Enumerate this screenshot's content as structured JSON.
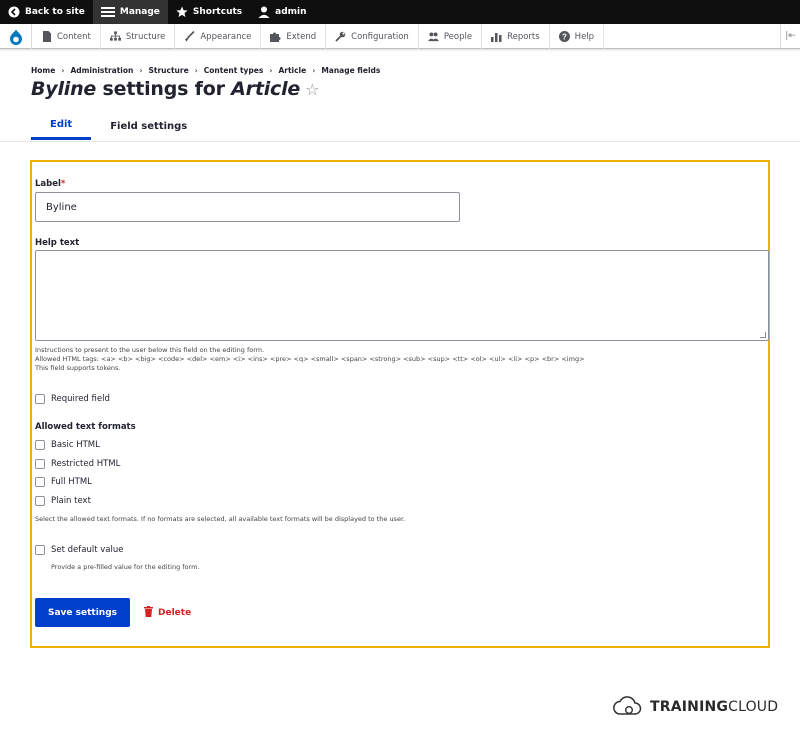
{
  "toolbar": {
    "back_to_site": "Back to site",
    "manage": "Manage",
    "shortcuts": "Shortcuts",
    "user": "admin"
  },
  "tray": {
    "items": [
      "Content",
      "Structure",
      "Appearance",
      "Extend",
      "Configuration",
      "People",
      "Reports",
      "Help"
    ]
  },
  "breadcrumb": [
    "Home",
    "Administration",
    "Structure",
    "Content types",
    "Article",
    "Manage fields"
  ],
  "title": {
    "field": "Byline",
    "middle": " settings for ",
    "bundle": "Article"
  },
  "tabs": [
    "Edit",
    "Field settings"
  ],
  "form": {
    "label_title": "Label",
    "label_required_mark": "*",
    "label_value": "Byline",
    "help_text_title": "Help text",
    "help_desc_1": "Instructions to present to the user below this field on the editing form.",
    "help_desc_2": "Allowed HTML tags: <a> <b> <big> <code> <del> <em> <i> <ins> <pre> <q> <small> <span> <strong> <sub> <sup> <tt> <ol> <ul> <li> <p> <br> <img>",
    "help_desc_3": "This field supports tokens.",
    "required_field": "Required field",
    "formats_title": "Allowed text formats",
    "formats": [
      "Basic HTML",
      "Restricted HTML",
      "Full HTML",
      "Plain text"
    ],
    "formats_desc": "Select the allowed text formats. If no formats are selected, all available text formats will be displayed to the user.",
    "default_value": "Set default value",
    "default_desc": "Provide a pre-filled value for the editing form.",
    "save": "Save settings",
    "delete": "Delete"
  },
  "brand": {
    "bold": "TRAINING",
    "regular": "CLOUD"
  },
  "colors": {
    "accent": "#003ecc",
    "highlight": "#f0b000",
    "danger": "#d72222"
  }
}
